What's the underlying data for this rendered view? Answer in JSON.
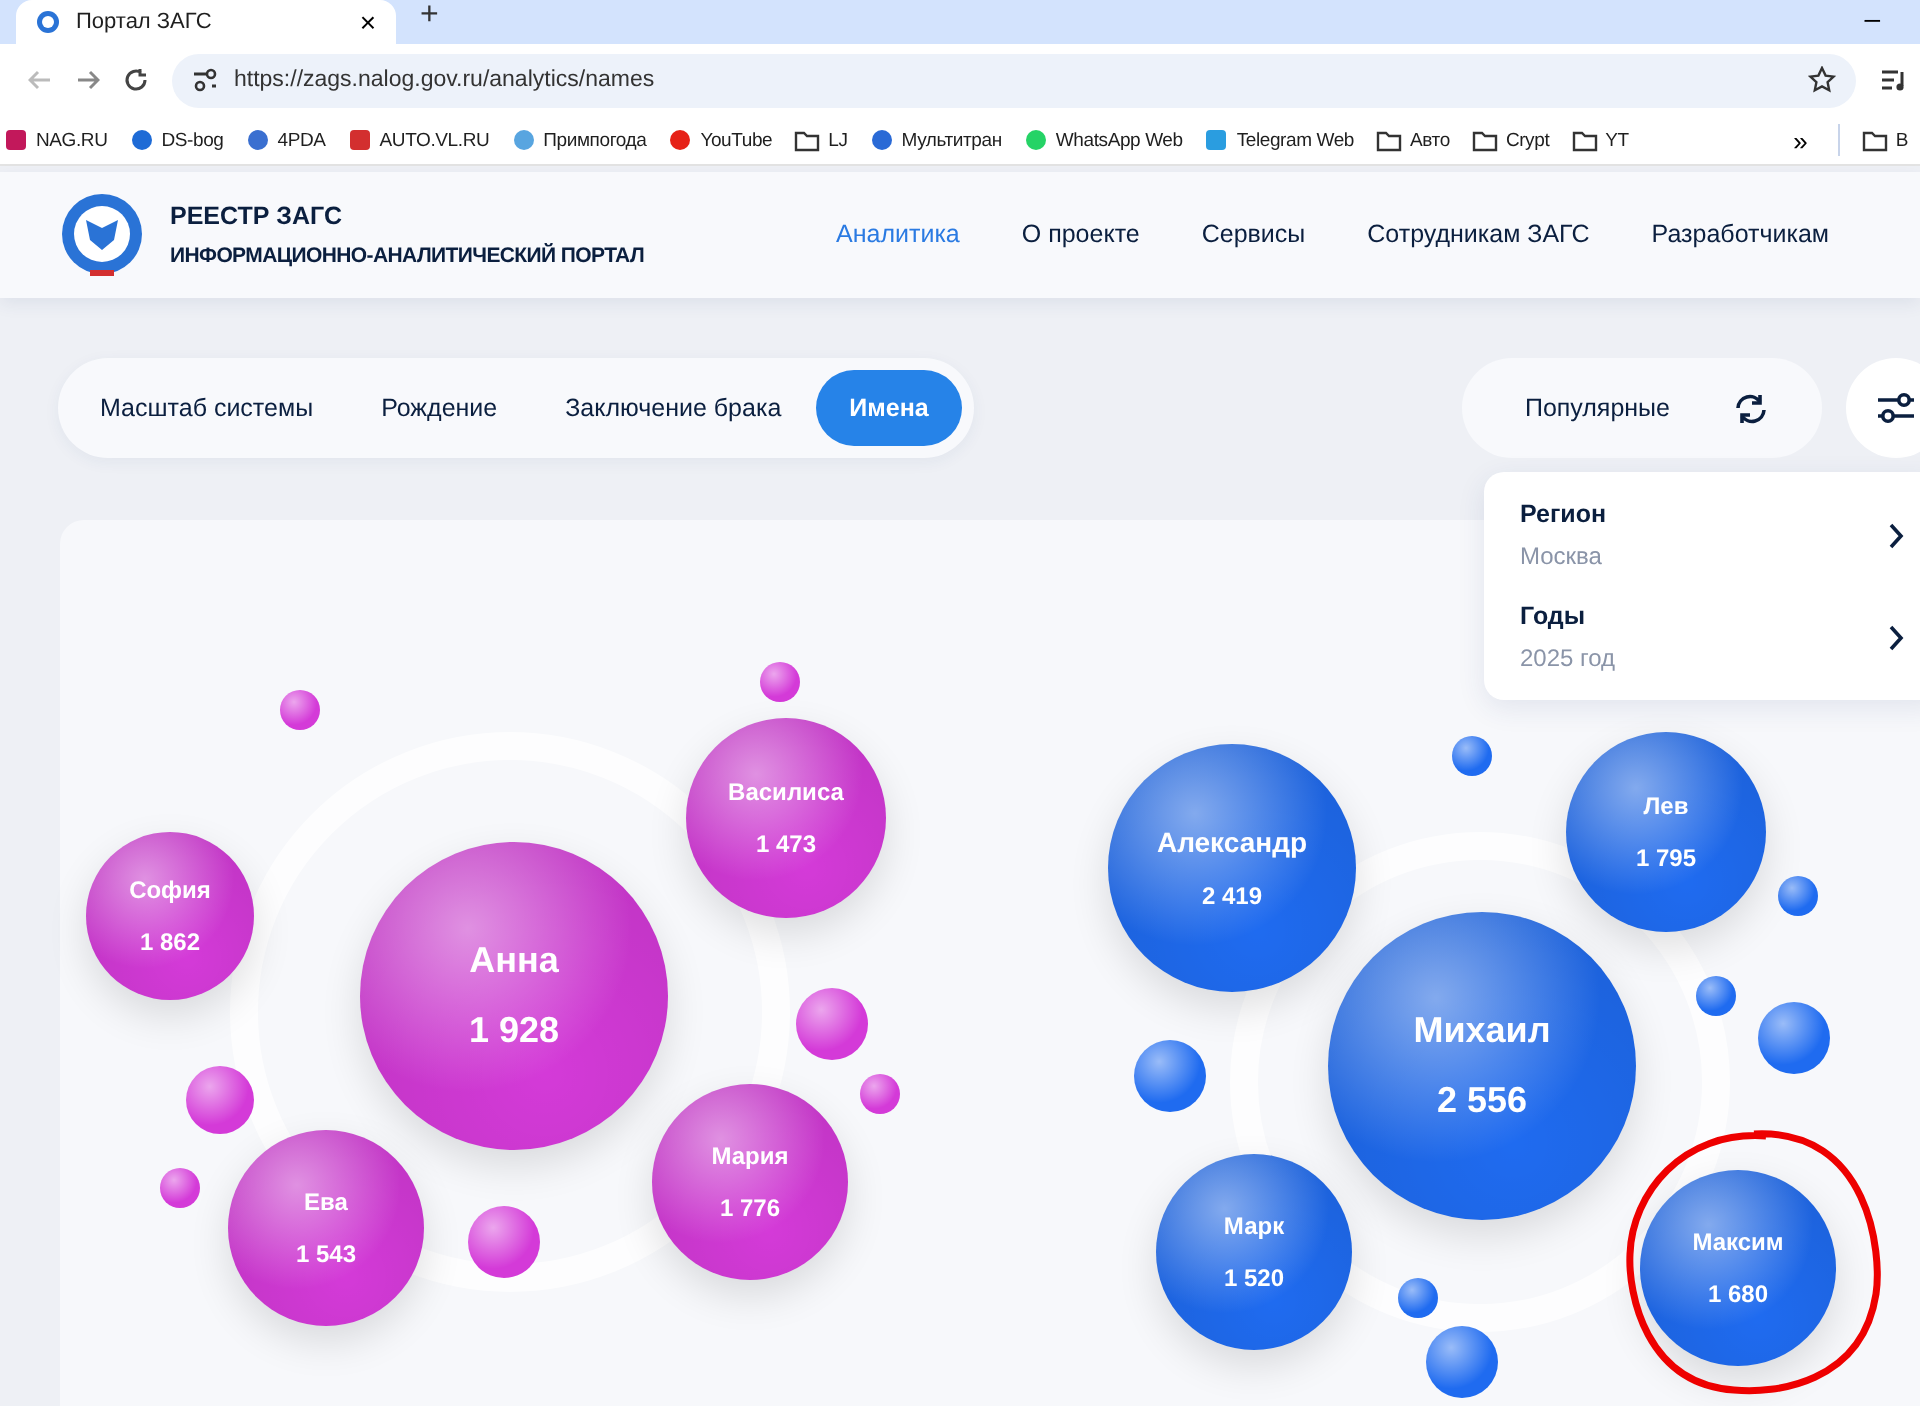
{
  "browser": {
    "tab_title": "Портал ЗАГС",
    "tab_close": "×",
    "new_tab": "+",
    "minimize": "–",
    "url": "https://zags.nalog.gov.ru/analytics/names",
    "bookmarks": [
      {
        "label": "NAG.RU",
        "kind": "site"
      },
      {
        "label": "DS-bog",
        "kind": "site"
      },
      {
        "label": "4PDA",
        "kind": "site"
      },
      {
        "label": "AUTO.VL.RU",
        "kind": "site"
      },
      {
        "label": "Примпогода",
        "kind": "site"
      },
      {
        "label": "YouTube",
        "kind": "site"
      },
      {
        "label": "LJ",
        "kind": "folder"
      },
      {
        "label": "Мультитран",
        "kind": "site"
      },
      {
        "label": "WhatsApp Web",
        "kind": "site"
      },
      {
        "label": "Telegram Web",
        "kind": "site"
      },
      {
        "label": "Авто",
        "kind": "folder"
      },
      {
        "label": "Crypt",
        "kind": "folder"
      },
      {
        "label": "YT",
        "kind": "folder"
      }
    ],
    "more": "»",
    "other_bookmarks": "B"
  },
  "header": {
    "title": "РЕЕСТР ЗАГС",
    "subtitle": "ИНФОРМАЦИОННО-АНАЛИТИЧЕСКИЙ ПОРТАЛ",
    "nav": [
      {
        "label": "Аналитика",
        "selected": true
      },
      {
        "label": "О проекте",
        "selected": false
      },
      {
        "label": "Сервисы",
        "selected": false
      },
      {
        "label": "Сотрудникам ЗАГС",
        "selected": false
      },
      {
        "label": "Разработчикам",
        "selected": false
      }
    ]
  },
  "sections": [
    {
      "label": "Масштаб системы",
      "selected": false
    },
    {
      "label": "Рождение",
      "selected": false
    },
    {
      "label": "Заключение брака",
      "selected": false
    },
    {
      "label": "Имена",
      "selected": true
    }
  ],
  "sort": {
    "label": "Популярные"
  },
  "filters": [
    {
      "label": "Регион",
      "value": "Москва"
    },
    {
      "label": "Годы",
      "value": "2025 год"
    }
  ],
  "groups": [
    {
      "color": "#d43ad8",
      "names": [
        {
          "name": "София",
          "count": "1 862"
        },
        {
          "name": "Анна",
          "count": "1 928"
        },
        {
          "name": "Василиса",
          "count": "1 473"
        },
        {
          "name": "Ева",
          "count": "1 543"
        },
        {
          "name": "Мария",
          "count": "1 776"
        }
      ]
    },
    {
      "color": "#1f6bf0",
      "names": [
        {
          "name": "Александр",
          "count": "2 419"
        },
        {
          "name": "Михаил",
          "count": "2 556"
        },
        {
          "name": "Лев",
          "count": "1 795"
        },
        {
          "name": "Марк",
          "count": "1 520"
        },
        {
          "name": "Максим",
          "count": "1 680",
          "circled": true
        }
      ]
    }
  ]
}
